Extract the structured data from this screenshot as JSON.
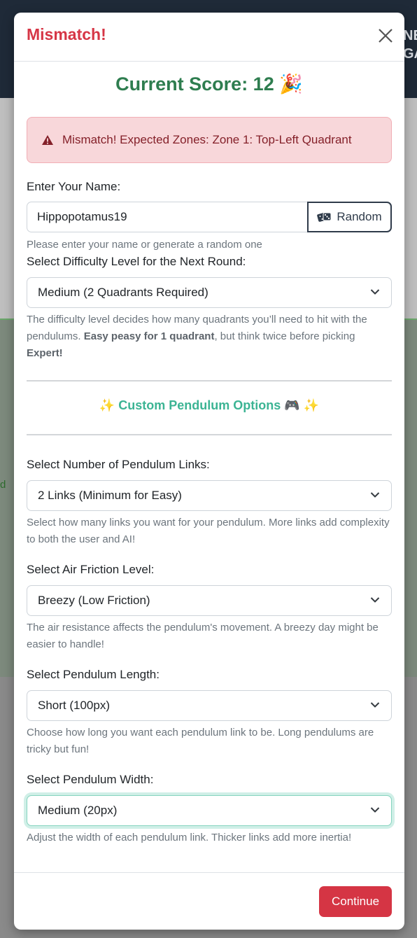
{
  "background": {
    "header_text": "NE GA",
    "left_text": "d"
  },
  "modal": {
    "title": "Mismatch!",
    "score_text": "Current Score: 12",
    "score_emoji": "🎉",
    "alert_text": "Mismatch! Expected Zones: Zone 1: Top-Left Quadrant",
    "name": {
      "label": "Enter Your Name:",
      "value": "Hippopotamus19",
      "random_label": "Random",
      "help": "Please enter your name or generate a random one"
    },
    "difficulty": {
      "label": "Select Difficulty Level for the Next Round:",
      "selected": "Medium (2 Quadrants Required)",
      "help_part1": "The difficulty level decides how many quadrants you’ll need to hit with the pendulums. ",
      "help_bold1": "Easy peasy for 1 quadrant",
      "help_part2": ", but think twice before picking ",
      "help_bold2": "Expert!"
    },
    "custom_section": {
      "emoji_left": "✨",
      "title": "Custom Pendulum Options",
      "emoji_game": "🎮",
      "emoji_right": "✨"
    },
    "links": {
      "label": "Select Number of Pendulum Links:",
      "selected": "2 Links (Minimum for Easy)",
      "help": "Select how many links you want for your pendulum. More links add complexity to both the user and AI!"
    },
    "friction": {
      "label": "Select Air Friction Level:",
      "selected": "Breezy (Low Friction)",
      "help": "The air resistance affects the pendulum's movement. A breezy day might be easier to handle!"
    },
    "length": {
      "label": "Select Pendulum Length:",
      "selected": "Short (100px)",
      "help": "Choose how long you want each pendulum link to be. Long pendulums are tricky but fun!"
    },
    "width": {
      "label": "Select Pendulum Width:",
      "selected": "Medium (20px)",
      "help": "Adjust the width of each pendulum link. Thicker links add more inertia!"
    },
    "continue_label": "Continue"
  },
  "colors": {
    "title_red": "#d63646",
    "score_green": "#2e7d4f",
    "section_teal": "#3cb494",
    "continue_bg": "#d53544"
  }
}
